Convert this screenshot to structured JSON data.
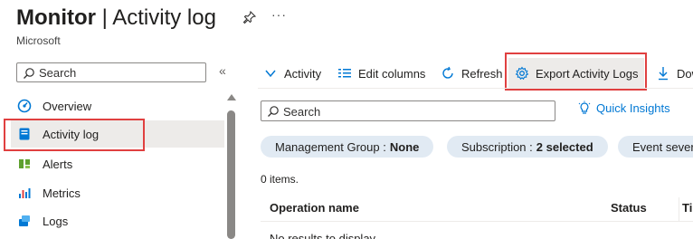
{
  "header": {
    "title_bold": "Monitor",
    "title_rest": " | Activity log",
    "subtitle": "Microsoft",
    "pin_icon": "pin-icon",
    "more_label": "···"
  },
  "sidebar": {
    "search_placeholder": "Search",
    "collapse_label": "«",
    "items": [
      {
        "label": "Overview",
        "icon": "overview-icon"
      },
      {
        "label": "Activity log",
        "icon": "activity-log-icon",
        "selected": true
      },
      {
        "label": "Alerts",
        "icon": "alerts-icon"
      },
      {
        "label": "Metrics",
        "icon": "metrics-icon"
      },
      {
        "label": "Logs",
        "icon": "logs-icon"
      }
    ]
  },
  "toolbar": {
    "activity_label": "Activity",
    "edit_columns_label": "Edit columns",
    "refresh_label": "Refresh",
    "export_label": "Export Activity Logs",
    "download_label": "Dow"
  },
  "main": {
    "search_placeholder": "Search",
    "quick_insights_label": "Quick Insights",
    "filters": [
      {
        "key": "Management Group :",
        "value": "None"
      },
      {
        "key": "Subscription :",
        "value": "2 selected"
      },
      {
        "key": "Event severi",
        "value": ""
      }
    ],
    "count_text": "0 items.",
    "columns": [
      "Operation name",
      "Status",
      "Ti"
    ],
    "empty_text": "No results to display"
  },
  "colors": {
    "accent": "#0078d4",
    "highlight_box": "#e04040",
    "pill_bg": "#e1eaf3",
    "selected_bg": "#edebe9"
  }
}
